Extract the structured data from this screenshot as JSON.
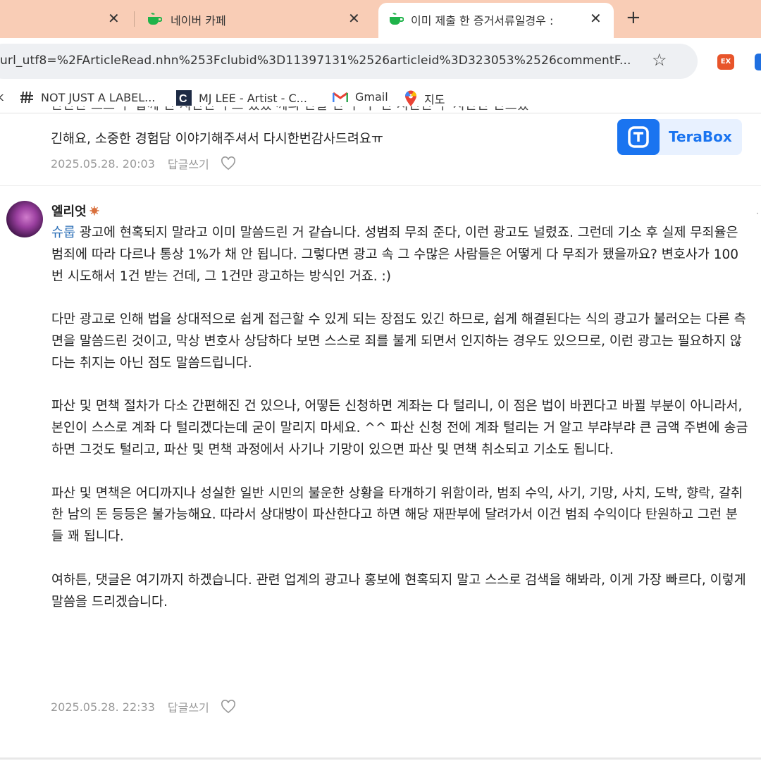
{
  "tabs": [
    {
      "label": ""
    },
    {
      "label": "네이버 카페"
    },
    {
      "label": "이미 제출 한 증거서류일경우 :"
    }
  ],
  "address": {
    "url": "url_utf8=%2FArticleRead.nhn%253Fclubid%3D11397131%2526articleid%3D323053%2526commentF..."
  },
  "extensions": {
    "ext1_label": "EX"
  },
  "bookmarks": [
    {
      "label": "NOT JUST A LABEL..."
    },
    {
      "label": "MJ LEE - Artist - C..."
    },
    {
      "label": "Gmail"
    },
    {
      "label": "지도"
    }
  ],
  "prev_comment": {
    "line_cut": "잔잔잔 으므 우 밥께 잔 지잔잔 구으 셨었 께의 잔잘 잔 우 구 잔 지잔잔 우 지잔잔 잔므잤",
    "line1": "긴해요, 소중한 경험담 이야기해주셔서 다시한번감사드려요ㅠ",
    "date": "2025.05.28. 20:03",
    "reply_label": "답글쓰기"
  },
  "ad": {
    "name": "TeraBox"
  },
  "comment": {
    "author": "엘리엇",
    "mention": "슈룹",
    "paragraph1": " 광고에 현혹되지 말라고 이미 말씀드린 거 같습니다. 성범죄 무죄 준다, 이런 광고도 널렸죠. 그런데 기소 후 실제 무죄율은 범죄에 따라 다르나 통상 1%가 채 안 됩니다. 그렇다면 광고 속 그 수많은 사람들은 어떻게 다 무죄가 됐을까요? 변호사가 100번 시도해서 1건 받는 건데, 그 1건만 광고하는 방식인 거죠. :)",
    "paragraph2": "다만 광고로 인해 법을 상대적으로 쉽게 접근할 수 있게 되는 장점도 있긴 하므로, 쉽게 해결된다는 식의 광고가 불러오는 다른 측면을 말씀드린 것이고, 막상 변호사 상담하다 보면 스스로 죄를 불게 되면서 인지하는 경우도 있으므로, 이런 광고는 필요하지 않다는 취지는 아닌 점도 말씀드립니다.",
    "paragraph3": "파산 및 면책 절차가 다소 간편해진 건 있으나, 어떻든 신청하면 계좌는 다 털리니, 이 점은 법이 바뀐다고 바뀔 부분이 아니라서, 본인이 스스로 계좌 다 털리겠다는데 굳이 말리지 마세요. ^^ 파산 신청 전에 계좌 털리는 거 알고 부랴부랴 큰 금액 주변에 송금하면 그것도 털리고, 파산 및 면책 과정에서 사기나 기망이 있으면 파산 및 면책 취소되고 기소도 됩니다.",
    "paragraph4": "파산 및 면책은 어디까지나 성실한 일반 시민의 불운한 상황을 타개하기 위함이라, 범죄 수익, 사기, 기망, 사치, 도박, 향락, 갈취한 남의 돈 등등은 불가능해요. 따라서 상대방이 파산한다고 하면 해당 재판부에 달려가서 이건 범죄 수익이다 탄원하고 그런 분들 꽤 됩니다.",
    "paragraph5": "여하튼, 댓글은 여기까지 하겠습니다. 관련 업계의 광고나 홍보에 현혹되지 말고 스스로 검색을 해봐라, 이게 가장 빠르다, 이렇게 말씀을 드리겠습니다.",
    "date": "2025.05.28. 22:33",
    "reply_label": "답글쓰기"
  },
  "colors": {
    "tabstrip": "#f9cdb6",
    "mention": "#2c6fb7",
    "terabox": "#1a74f0",
    "meta": "#999999"
  }
}
